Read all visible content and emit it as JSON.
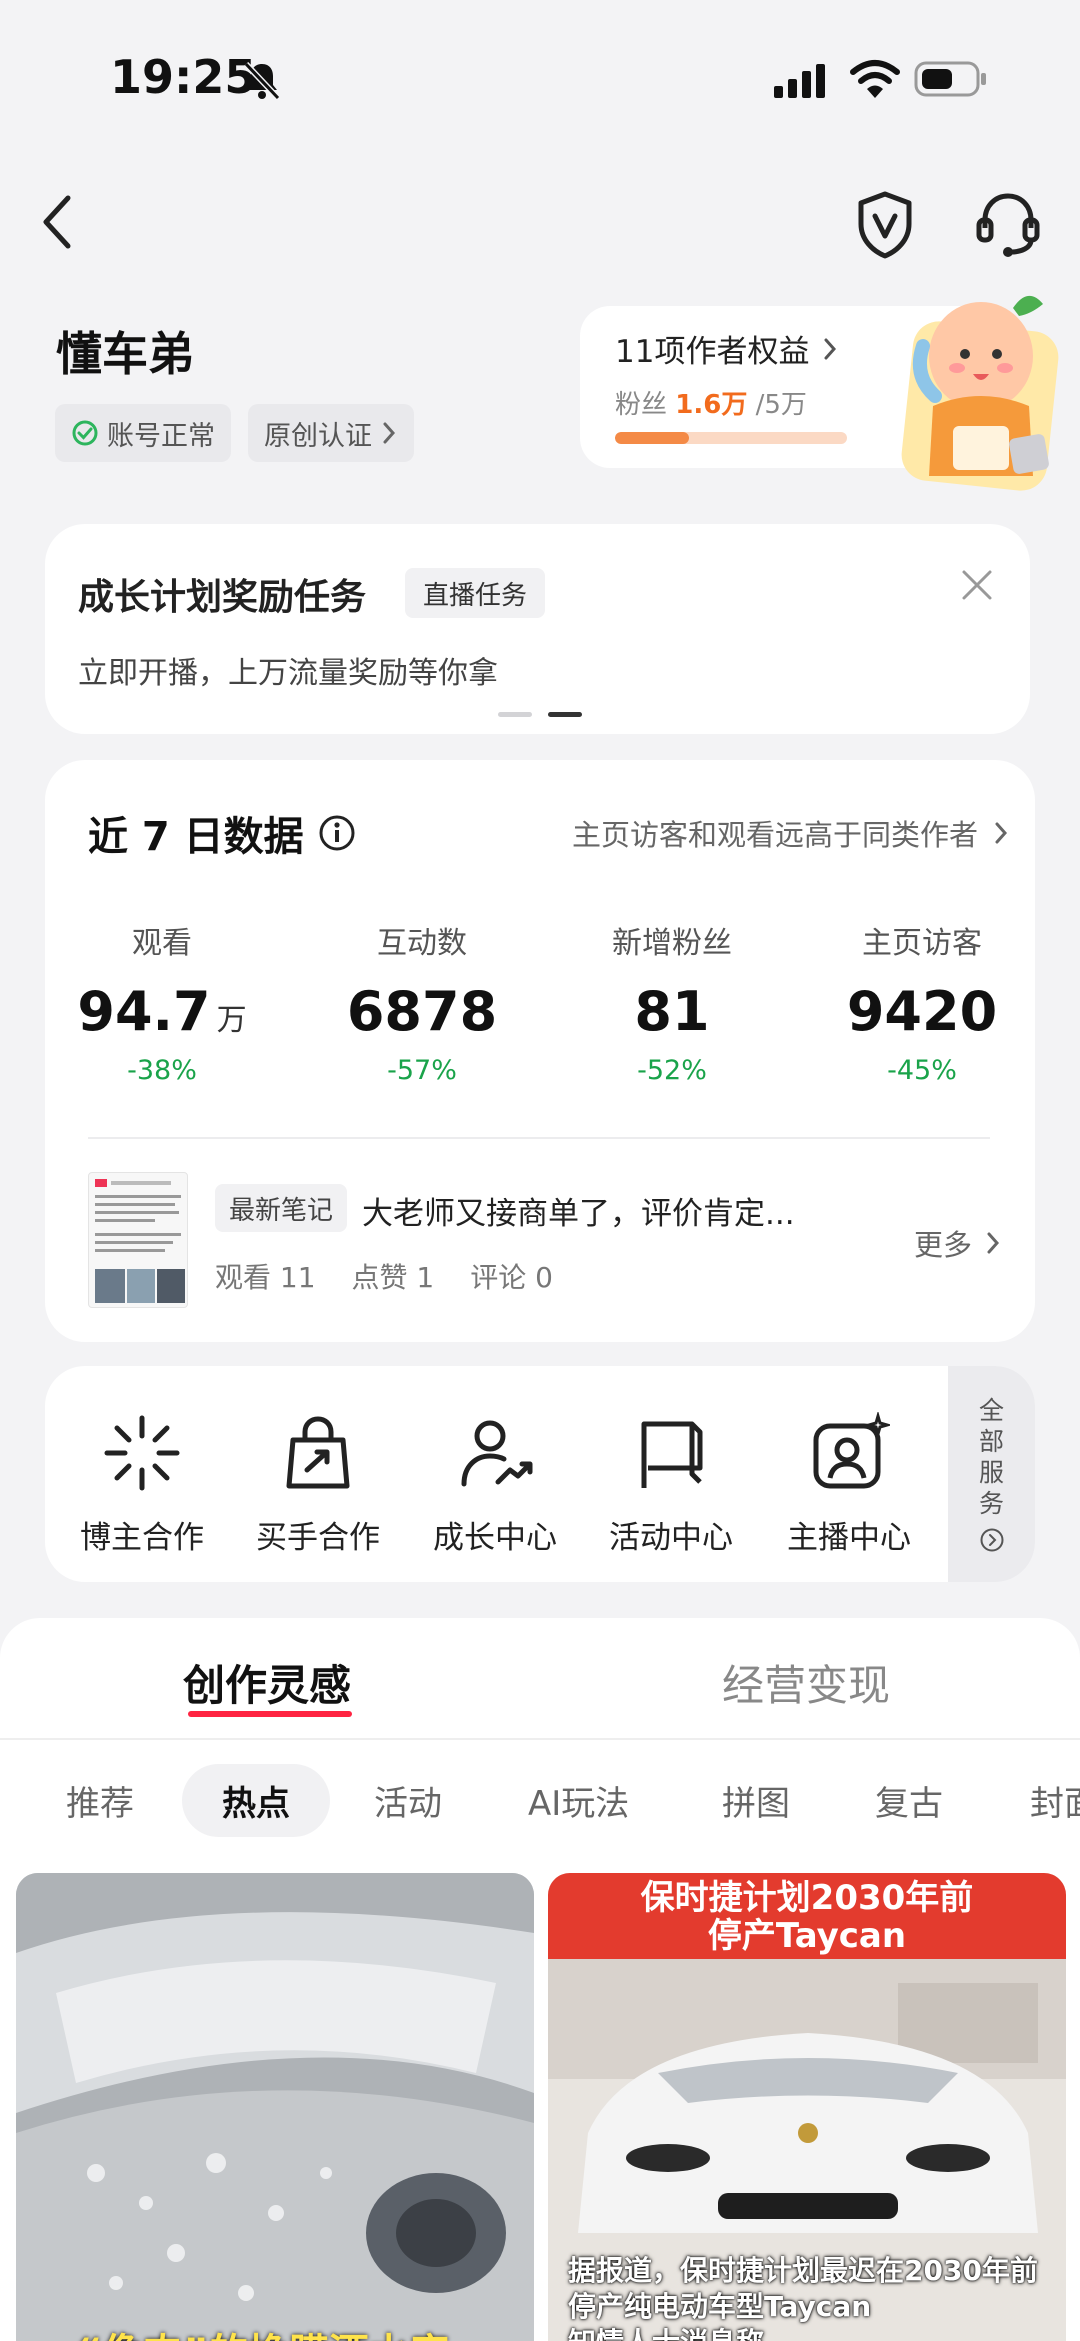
{
  "status_bar": {
    "time": "19:25"
  },
  "profile": {
    "name": "懂车弟",
    "account_status": "账号正常",
    "original_cert": "原创认证"
  },
  "rights": {
    "title": "11项作者权益",
    "fans_label": "粉丝",
    "fans_current": "1.6万",
    "fans_target": "/5万",
    "progress_fraction": 0.32
  },
  "growth": {
    "title": "成长计划奖励任务",
    "tag": "直播任务",
    "description": "立即开播，上万流量奖励等你拿"
  },
  "data7": {
    "title": "近 7 日数据",
    "compare_text": "主页访客和观看远高于同类作者",
    "metrics": [
      {
        "label": "观看",
        "value": "94.7",
        "unit": "万",
        "change": "-38%"
      },
      {
        "label": "互动数",
        "value": "6878",
        "unit": "",
        "change": "-57%"
      },
      {
        "label": "新增粉丝",
        "value": "81",
        "unit": "",
        "change": "-52%"
      },
      {
        "label": "主页访客",
        "value": "9420",
        "unit": "",
        "change": "-45%"
      }
    ],
    "latest_note": {
      "tag": "最新笔记",
      "title": "大老师又接商单了，评价肯定...",
      "views": "观看 11",
      "likes": "点赞 1",
      "comments": "评论 0",
      "more": "更多"
    }
  },
  "services": {
    "items": [
      {
        "label": "博主合作",
        "icon": "sparkle-burst-icon"
      },
      {
        "label": "买手合作",
        "icon": "shopping-bag-icon"
      },
      {
        "label": "成长中心",
        "icon": "user-growth-icon"
      },
      {
        "label": "活动中心",
        "icon": "flag-icon"
      },
      {
        "label": "主播中心",
        "icon": "camera-user-icon"
      }
    ],
    "all_label_chars": [
      "全",
      "部",
      "服",
      "务"
    ]
  },
  "main_tabs": [
    "创作灵感",
    "经营变现"
  ],
  "sub_tabs": [
    "推荐",
    "热点",
    "活动",
    "AI玩法",
    "拼图",
    "复古",
    "封面"
  ],
  "feed": {
    "right_banner_line1": "保时捷计划2030年前",
    "right_banner_line2": "停产Taycan",
    "right_caption": "据报道，保时捷计划最迟在2030年前停产纯电动车型Taycan",
    "right_caption2": "知情人士消息称",
    "left_caption": "“像肉”的換膜酒水库"
  },
  "colors": {
    "accent_red": "#ff2442",
    "positive_change": "#1aa34a",
    "fans_highlight": "#f26b1d"
  }
}
